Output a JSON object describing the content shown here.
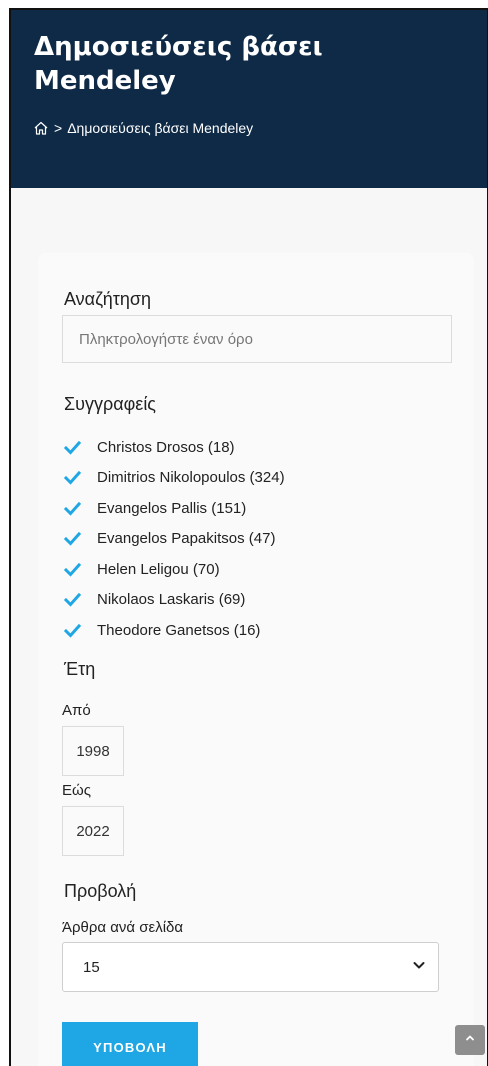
{
  "header": {
    "title": "Δημοσιεύσεις βάσει Mendeley",
    "breadcrumb": {
      "home_icon": "home-icon",
      "separator": ">",
      "current": "Δημοσιεύσεις βάσει Mendeley"
    }
  },
  "filters": {
    "search": {
      "heading": "Αναζήτηση",
      "value": "",
      "placeholder": "Πληκτρολογήστε έναν όρο"
    },
    "authors": {
      "heading": "Συγγραφείς",
      "items": [
        {
          "label": "Christos Drosos (18)",
          "checked": true
        },
        {
          "label": "Dimitrios Nikolopoulos (324)",
          "checked": true
        },
        {
          "label": "Evangelos Pallis (151)",
          "checked": true
        },
        {
          "label": "Evangelos Papakitsos (47)",
          "checked": true
        },
        {
          "label": "Helen Leligou (70)",
          "checked": true
        },
        {
          "label": "Nikolaos Laskaris (69)",
          "checked": true
        },
        {
          "label": "Theodore Ganetsos (16)",
          "checked": true
        }
      ]
    },
    "years": {
      "heading": "Έτη",
      "from_label": "Από",
      "from_value": "1998",
      "to_label": "Εώς",
      "to_value": "2022"
    },
    "view": {
      "heading": "Προβολή",
      "per_page_label": "Άρθρα ανά σελίδα",
      "per_page_value": "15"
    },
    "submit_label": "ΥΠΟΒΟΛΗ"
  },
  "colors": {
    "header_bg": "#0f2a47",
    "accent": "#1ea7e4",
    "page_bg": "#f7f7f7"
  },
  "icons": {
    "checkbox": "checkmark-icon",
    "select": "chevron-down-icon",
    "scroll_top": "chevron-up-icon"
  }
}
